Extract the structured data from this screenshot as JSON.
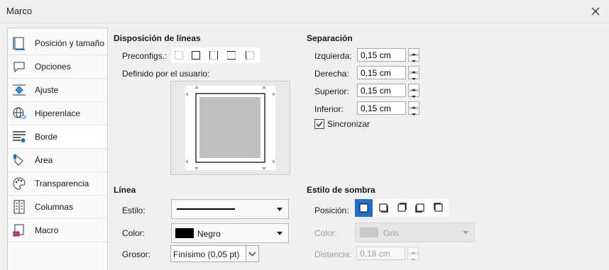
{
  "window": {
    "title": "Marco"
  },
  "sidebar": {
    "items": [
      {
        "label": "Posición y tamaño",
        "icon": "page-position-icon"
      },
      {
        "label": "Opciones",
        "icon": "speech-bubble-icon"
      },
      {
        "label": "Ajuste",
        "icon": "wrap-diamond-icon"
      },
      {
        "label": "Hiperenlace",
        "icon": "globe-icon"
      },
      {
        "label": "Borde",
        "icon": "borders-icon"
      },
      {
        "label": "Área",
        "icon": "paint-bucket-icon"
      },
      {
        "label": "Transparencia",
        "icon": "palette-icon"
      },
      {
        "label": "Columnas",
        "icon": "columns-icon"
      },
      {
        "label": "Macro",
        "icon": "macro-scroll-icon"
      }
    ],
    "active_index": 4
  },
  "line_arrangement": {
    "heading": "Disposición de líneas",
    "presets_label": "Preconfigs.:",
    "user_defined_label": "Definido por el usuario:"
  },
  "padding": {
    "heading": "Separación",
    "left_label": "Izquierda:",
    "left_value": "0,15 cm",
    "right_label": "Derecha:",
    "right_value": "0,15 cm",
    "top_label": "Superior:",
    "top_value": "0,15 cm",
    "bottom_label": "Inferior:",
    "bottom_value": "0,15 cm",
    "sync_label": "Sincronizar",
    "sync_checked": true
  },
  "line": {
    "heading": "Línea",
    "style_label": "Estilo:",
    "color_label": "Color:",
    "color_value": "Negro",
    "color_swatch": "#000000",
    "width_label": "Grosor:",
    "width_value": "Finísimo (0,05 pt)"
  },
  "shadow": {
    "heading": "Estilo de sombra",
    "position_label": "Posición:",
    "color_label": "Color:",
    "color_value": "Gris",
    "color_swatch": "#c0c0c0",
    "distance_label": "Distancia:",
    "distance_value": "0,18 cm"
  },
  "colors": {
    "accent": "#1e6fd0",
    "preview_fill": "#c0bfc1"
  }
}
